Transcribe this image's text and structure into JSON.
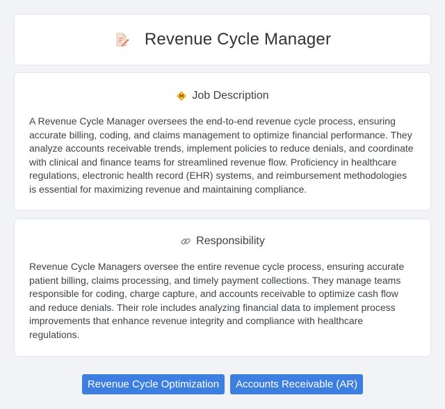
{
  "header": {
    "title": "Revenue Cycle Manager",
    "icon": "document-pencil-icon"
  },
  "job_description": {
    "heading": "Job Description",
    "icon": "badge-icon",
    "text": "A Revenue Cycle Manager oversees the end-to-end revenue cycle process, ensuring accurate billing, coding, and claims management to optimize financial performance. They analyze accounts receivable trends, implement policies to reduce denials, and coordinate with clinical and finance teams for streamlined revenue flow. Proficiency in healthcare regulations, electronic health record (EHR) systems, and reimbursement methodologies is essential for maximizing revenue and maintaining compliance."
  },
  "responsibility": {
    "heading": "Responsibility",
    "icon": "link-icon",
    "text": "Revenue Cycle Managers oversee the entire revenue cycle process, ensuring accurate patient billing, claims processing, and timely payment collections. They manage teams responsible for coding, charge capture, and accounts receivable to optimize cash flow and reduce denials. Their role includes analyzing financial data to implement process improvements that enhance revenue integrity and compliance with healthcare regulations."
  },
  "tags": [
    {
      "label": "Revenue Cycle Optimization"
    },
    {
      "label": "Accounts Receivable (AR)"
    }
  ],
  "colors": {
    "tag_background": "#3d7fe0",
    "page_background": "#f1f3f6"
  }
}
